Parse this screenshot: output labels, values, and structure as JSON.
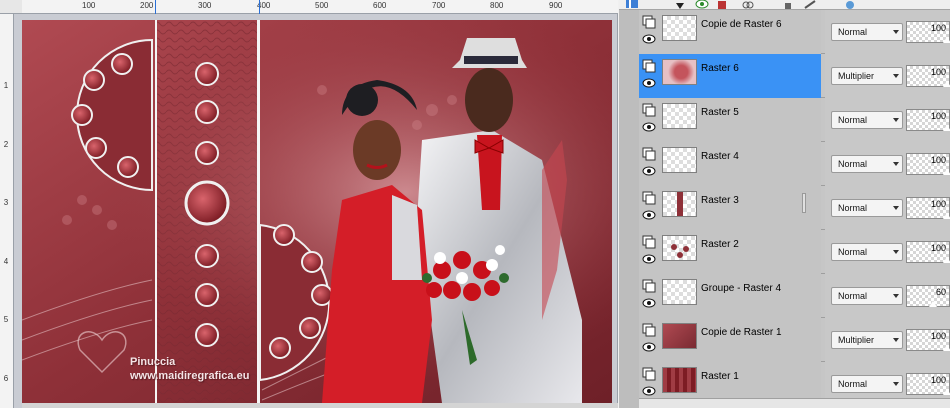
{
  "rulers": {
    "top_labels": [
      "100",
      "200",
      "300",
      "400",
      "500",
      "600",
      "700",
      "800",
      "900"
    ],
    "left_labels": [
      "1",
      "2",
      "3",
      "4",
      "5",
      "6"
    ]
  },
  "watermark": {
    "line1": "Pinuccia",
    "line2": "www.maidiregrafica.eu"
  },
  "layers": [
    {
      "name": "Copie de Raster 6",
      "blend": "Normal",
      "opacity": "100",
      "selected": false,
      "thumb": "couple"
    },
    {
      "name": "Raster 6",
      "blend": "Multiplier",
      "opacity": "100",
      "selected": true,
      "thumb": "pinkblur"
    },
    {
      "name": "Raster 5",
      "blend": "Normal",
      "opacity": "100",
      "selected": false,
      "thumb": "empty"
    },
    {
      "name": "Raster 4",
      "blend": "Normal",
      "opacity": "100",
      "selected": false,
      "thumb": "empty"
    },
    {
      "name": "Raster 3",
      "blend": "Normal",
      "opacity": "100",
      "selected": false,
      "thumb": "strip"
    },
    {
      "name": "Raster 2",
      "blend": "Normal",
      "opacity": "100",
      "selected": false,
      "thumb": "dots"
    },
    {
      "name": "Groupe - Raster 4",
      "blend": "Normal",
      "opacity": "60",
      "selected": false,
      "thumb": "empty"
    },
    {
      "name": "Copie de Raster 1",
      "blend": "Multiplier",
      "opacity": "100",
      "selected": false,
      "thumb": "redwall"
    },
    {
      "name": "Raster 1",
      "blend": "Normal",
      "opacity": "100",
      "selected": false,
      "thumb": "pattern"
    }
  ],
  "colors": {
    "selection": "#3a92f5",
    "background_red": "#a03c44"
  }
}
